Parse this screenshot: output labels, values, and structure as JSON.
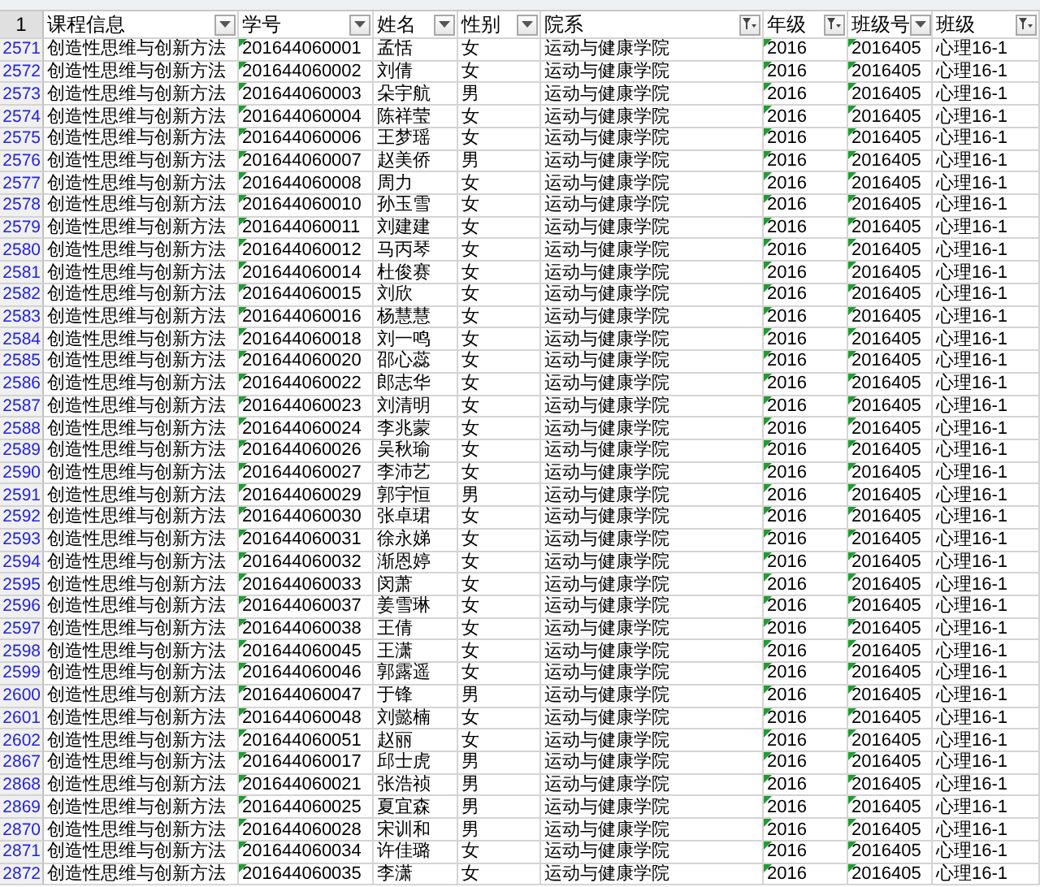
{
  "sheet": {
    "header_row_number": "1",
    "rows_filtered": true,
    "columns": [
      {
        "label": "课程信息",
        "filtered": false,
        "number_stored_as_text": false
      },
      {
        "label": "学号",
        "filtered": false,
        "number_stored_as_text": true
      },
      {
        "label": "姓名",
        "filtered": false,
        "number_stored_as_text": false
      },
      {
        "label": "性别",
        "filtered": false,
        "number_stored_as_text": false
      },
      {
        "label": "院系",
        "filtered": true,
        "number_stored_as_text": false
      },
      {
        "label": "年级",
        "filtered": true,
        "number_stored_as_text": true
      },
      {
        "label": "班级号",
        "filtered": false,
        "number_stored_as_text": true
      },
      {
        "label": "班级",
        "filtered": true,
        "number_stored_as_text": false
      }
    ],
    "rows": [
      {
        "row_number": "2571",
        "cells": [
          "创造性思维与创新方法",
          "201644060001",
          "孟恬",
          "女",
          "运动与健康学院",
          "2016",
          "2016405",
          "心理16-1"
        ]
      },
      {
        "row_number": "2572",
        "cells": [
          "创造性思维与创新方法",
          "201644060002",
          "刘倩",
          "女",
          "运动与健康学院",
          "2016",
          "2016405",
          "心理16-1"
        ]
      },
      {
        "row_number": "2573",
        "cells": [
          "创造性思维与创新方法",
          "201644060003",
          "朵宇航",
          "男",
          "运动与健康学院",
          "2016",
          "2016405",
          "心理16-1"
        ]
      },
      {
        "row_number": "2574",
        "cells": [
          "创造性思维与创新方法",
          "201644060004",
          "陈祥莹",
          "女",
          "运动与健康学院",
          "2016",
          "2016405",
          "心理16-1"
        ]
      },
      {
        "row_number": "2575",
        "cells": [
          "创造性思维与创新方法",
          "201644060006",
          "王梦瑶",
          "女",
          "运动与健康学院",
          "2016",
          "2016405",
          "心理16-1"
        ]
      },
      {
        "row_number": "2576",
        "cells": [
          "创造性思维与创新方法",
          "201644060007",
          "赵美侨",
          "男",
          "运动与健康学院",
          "2016",
          "2016405",
          "心理16-1"
        ]
      },
      {
        "row_number": "2577",
        "cells": [
          "创造性思维与创新方法",
          "201644060008",
          "周力",
          "女",
          "运动与健康学院",
          "2016",
          "2016405",
          "心理16-1"
        ]
      },
      {
        "row_number": "2578",
        "cells": [
          "创造性思维与创新方法",
          "201644060010",
          "孙玉雪",
          "女",
          "运动与健康学院",
          "2016",
          "2016405",
          "心理16-1"
        ]
      },
      {
        "row_number": "2579",
        "cells": [
          "创造性思维与创新方法",
          "201644060011",
          "刘建建",
          "女",
          "运动与健康学院",
          "2016",
          "2016405",
          "心理16-1"
        ]
      },
      {
        "row_number": "2580",
        "cells": [
          "创造性思维与创新方法",
          "201644060012",
          "马丙琴",
          "女",
          "运动与健康学院",
          "2016",
          "2016405",
          "心理16-1"
        ]
      },
      {
        "row_number": "2581",
        "cells": [
          "创造性思维与创新方法",
          "201644060014",
          "杜俊赛",
          "女",
          "运动与健康学院",
          "2016",
          "2016405",
          "心理16-1"
        ]
      },
      {
        "row_number": "2582",
        "cells": [
          "创造性思维与创新方法",
          "201644060015",
          "刘欣",
          "女",
          "运动与健康学院",
          "2016",
          "2016405",
          "心理16-1"
        ]
      },
      {
        "row_number": "2583",
        "cells": [
          "创造性思维与创新方法",
          "201644060016",
          "杨慧慧",
          "女",
          "运动与健康学院",
          "2016",
          "2016405",
          "心理16-1"
        ]
      },
      {
        "row_number": "2584",
        "cells": [
          "创造性思维与创新方法",
          "201644060018",
          "刘一鸣",
          "女",
          "运动与健康学院",
          "2016",
          "2016405",
          "心理16-1"
        ]
      },
      {
        "row_number": "2585",
        "cells": [
          "创造性思维与创新方法",
          "201644060020",
          "邵心蕊",
          "女",
          "运动与健康学院",
          "2016",
          "2016405",
          "心理16-1"
        ]
      },
      {
        "row_number": "2586",
        "cells": [
          "创造性思维与创新方法",
          "201644060022",
          "郎志华",
          "女",
          "运动与健康学院",
          "2016",
          "2016405",
          "心理16-1"
        ]
      },
      {
        "row_number": "2587",
        "cells": [
          "创造性思维与创新方法",
          "201644060023",
          "刘清明",
          "女",
          "运动与健康学院",
          "2016",
          "2016405",
          "心理16-1"
        ]
      },
      {
        "row_number": "2588",
        "cells": [
          "创造性思维与创新方法",
          "201644060024",
          "李兆蒙",
          "女",
          "运动与健康学院",
          "2016",
          "2016405",
          "心理16-1"
        ]
      },
      {
        "row_number": "2589",
        "cells": [
          "创造性思维与创新方法",
          "201644060026",
          "吴秋瑜",
          "女",
          "运动与健康学院",
          "2016",
          "2016405",
          "心理16-1"
        ]
      },
      {
        "row_number": "2590",
        "cells": [
          "创造性思维与创新方法",
          "201644060027",
          "李沛艺",
          "女",
          "运动与健康学院",
          "2016",
          "2016405",
          "心理16-1"
        ]
      },
      {
        "row_number": "2591",
        "cells": [
          "创造性思维与创新方法",
          "201644060029",
          "郭宇恒",
          "男",
          "运动与健康学院",
          "2016",
          "2016405",
          "心理16-1"
        ]
      },
      {
        "row_number": "2592",
        "cells": [
          "创造性思维与创新方法",
          "201644060030",
          "张卓珺",
          "女",
          "运动与健康学院",
          "2016",
          "2016405",
          "心理16-1"
        ]
      },
      {
        "row_number": "2593",
        "cells": [
          "创造性思维与创新方法",
          "201644060031",
          "徐永娣",
          "女",
          "运动与健康学院",
          "2016",
          "2016405",
          "心理16-1"
        ]
      },
      {
        "row_number": "2594",
        "cells": [
          "创造性思维与创新方法",
          "201644060032",
          "渐恩婷",
          "女",
          "运动与健康学院",
          "2016",
          "2016405",
          "心理16-1"
        ]
      },
      {
        "row_number": "2595",
        "cells": [
          "创造性思维与创新方法",
          "201644060033",
          "闵萧",
          "女",
          "运动与健康学院",
          "2016",
          "2016405",
          "心理16-1"
        ]
      },
      {
        "row_number": "2596",
        "cells": [
          "创造性思维与创新方法",
          "201644060037",
          "姜雪琳",
          "女",
          "运动与健康学院",
          "2016",
          "2016405",
          "心理16-1"
        ]
      },
      {
        "row_number": "2597",
        "cells": [
          "创造性思维与创新方法",
          "201644060038",
          "王倩",
          "女",
          "运动与健康学院",
          "2016",
          "2016405",
          "心理16-1"
        ]
      },
      {
        "row_number": "2598",
        "cells": [
          "创造性思维与创新方法",
          "201644060045",
          "王潇",
          "女",
          "运动与健康学院",
          "2016",
          "2016405",
          "心理16-1"
        ]
      },
      {
        "row_number": "2599",
        "cells": [
          "创造性思维与创新方法",
          "201644060046",
          "郭露遥",
          "女",
          "运动与健康学院",
          "2016",
          "2016405",
          "心理16-1"
        ]
      },
      {
        "row_number": "2600",
        "cells": [
          "创造性思维与创新方法",
          "201644060047",
          "于锋",
          "男",
          "运动与健康学院",
          "2016",
          "2016405",
          "心理16-1"
        ]
      },
      {
        "row_number": "2601",
        "cells": [
          "创造性思维与创新方法",
          "201644060048",
          "刘懿楠",
          "女",
          "运动与健康学院",
          "2016",
          "2016405",
          "心理16-1"
        ]
      },
      {
        "row_number": "2602",
        "cells": [
          "创造性思维与创新方法",
          "201644060051",
          "赵丽",
          "女",
          "运动与健康学院",
          "2016",
          "2016405",
          "心理16-1"
        ]
      },
      {
        "row_number": "2867",
        "cells": [
          "创造性思维与创新方法",
          "201644060017",
          "邱士虎",
          "男",
          "运动与健康学院",
          "2016",
          "2016405",
          "心理16-1"
        ]
      },
      {
        "row_number": "2868",
        "cells": [
          "创造性思维与创新方法",
          "201644060021",
          "张浩祯",
          "男",
          "运动与健康学院",
          "2016",
          "2016405",
          "心理16-1"
        ]
      },
      {
        "row_number": "2869",
        "cells": [
          "创造性思维与创新方法",
          "201644060025",
          "夏宜森",
          "男",
          "运动与健康学院",
          "2016",
          "2016405",
          "心理16-1"
        ]
      },
      {
        "row_number": "2870",
        "cells": [
          "创造性思维与创新方法",
          "201644060028",
          "宋训和",
          "男",
          "运动与健康学院",
          "2016",
          "2016405",
          "心理16-1"
        ]
      },
      {
        "row_number": "2871",
        "cells": [
          "创造性思维与创新方法",
          "201644060034",
          "许佳璐",
          "女",
          "运动与健康学院",
          "2016",
          "2016405",
          "心理16-1"
        ]
      },
      {
        "row_number": "2872",
        "cells": [
          "创造性思维与创新方法",
          "201644060035",
          "李潇",
          "女",
          "运动与健康学院",
          "2016",
          "2016405",
          "心理16-1"
        ]
      }
    ]
  }
}
